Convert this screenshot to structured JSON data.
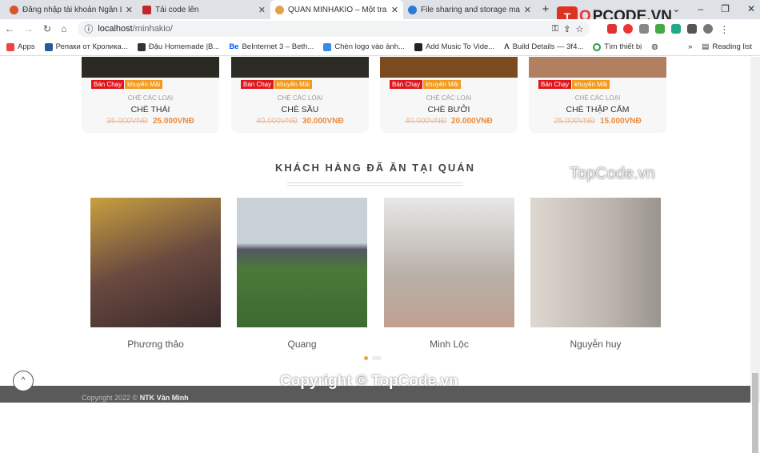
{
  "browser": {
    "tabs": [
      {
        "title": "Đăng nhập tài khoản Ngân Lượng",
        "color": "#d9532b",
        "active": false
      },
      {
        "title": "Tải code lên",
        "color": "#c0282d",
        "active": false
      },
      {
        "title": "QUÁN MINHAKIO – Một trang web",
        "color": "#e5a04b",
        "active": true
      },
      {
        "title": "File sharing and storage made simple",
        "color": "#2a7ad6",
        "active": false
      }
    ],
    "url_host": "localhost",
    "url_path": "/minhakio/",
    "bookmarks": [
      "Apps",
      "Репаки от Кролика...",
      "Đậu Homemade |B...",
      "BeInternet 3 – Beth...",
      "Chèn logo vào ảnh...",
      "Add Music To Vide...",
      "Build Details — 3f4...",
      "Tìm thiết bị"
    ],
    "bookmark_more": "»",
    "reading_list": "Reading list"
  },
  "logo": {
    "text_a": "T",
    "text_b": "O",
    "text_c": "PCODE.VN"
  },
  "products": [
    {
      "badge1": "Bán Chạy",
      "badge2": "khuyến Mãi",
      "category": "CHÈ CÁC LOẠI",
      "name": "CHÈ THÁI",
      "old_price": "35.000VNĐ",
      "price": "25.000VNĐ"
    },
    {
      "badge1": "Bán Chạy",
      "badge2": "khuyến Mãi",
      "category": "CHÈ CÁC LOẠI",
      "name": "CHÈ SẦU",
      "old_price": "40.000VNĐ",
      "price": "30.000VNĐ"
    },
    {
      "badge1": "Bán Chạy",
      "badge2": "khuyến Mãi",
      "category": "CHÈ CÁC LOẠI",
      "name": "CHÈ BƯỞI",
      "old_price": "40.000VNĐ",
      "price": "20.000VNĐ"
    },
    {
      "badge1": "Bán Chạy",
      "badge2": "khuyến Mãi",
      "category": "CHÈ CÁC LOẠI",
      "name": "CHÈ THẬP CẨM",
      "old_price": "25.000VNĐ",
      "price": "15.000VNĐ"
    }
  ],
  "section_title": "KHÁCH HÀNG ĐÃ ĂN TẠI QUÁN",
  "customers": [
    "Phương thảo",
    "Quang",
    "Minh Lộc",
    "Nguyễn huy"
  ],
  "footer": {
    "prefix": "Copyright 2022 ©",
    "author": "NTK Văn Minh"
  },
  "watermarks": {
    "center": "Copyright © TopCode.vn",
    "card": "TopCode.vn"
  }
}
